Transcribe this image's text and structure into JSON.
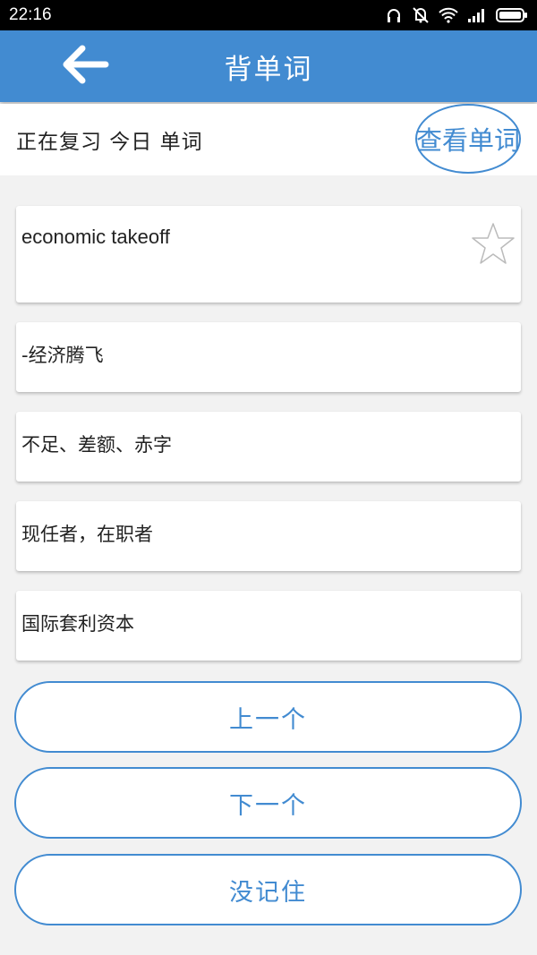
{
  "status_bar": {
    "time": "22:16",
    "icons": [
      "headphones-icon",
      "vibrate-off-icon",
      "wifi-icon",
      "signal-icon",
      "battery-icon"
    ]
  },
  "app_bar": {
    "title": "背单词",
    "back_icon": "arrow-left-icon",
    "color": "#428bd1"
  },
  "sub_header": {
    "review_status": "正在复习 今日 单词",
    "view_words_label": "查看单词"
  },
  "word_card": {
    "word": "economic takeoff",
    "favorite_icon": "star-outline-icon"
  },
  "options": [
    {
      "label": "-经济腾飞"
    },
    {
      "label": "不足、差额、赤字"
    },
    {
      "label": "现任者，在职者"
    },
    {
      "label": "国际套利资本"
    }
  ],
  "actions": {
    "previous_label": "上一个",
    "next_label": "下一个",
    "forgot_label": "没记住"
  }
}
